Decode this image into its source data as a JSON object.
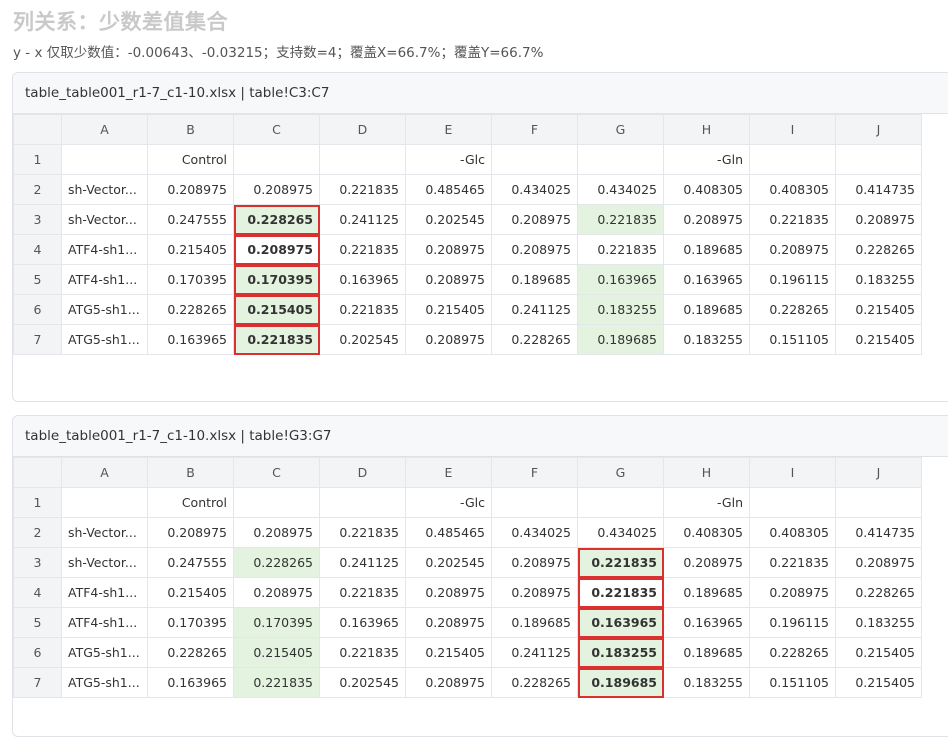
{
  "page": {
    "title": "列关系：少数差值集合",
    "subtitle": "y - x 仅取少数值：-0.00643、-0.03215；支持数=4；覆盖X=66.7%；覆盖Y=66.7%"
  },
  "columns": [
    "",
    "A",
    "B",
    "C",
    "D",
    "E",
    "F",
    "G",
    "H",
    "I",
    "J"
  ],
  "rows": [
    [
      "1",
      "",
      "Control",
      "",
      "",
      "-Glc",
      "",
      "",
      "-Gln",
      "",
      ""
    ],
    [
      "2",
      "sh-Vector...",
      "0.208975",
      "0.208975",
      "0.221835",
      "0.485465",
      "0.434025",
      "0.434025",
      "0.408305",
      "0.408305",
      "0.414735"
    ],
    [
      "3",
      "sh-Vector...",
      "0.247555",
      "0.228265",
      "0.241125",
      "0.202545",
      "0.208975",
      "0.221835",
      "0.208975",
      "0.221835",
      "0.208975"
    ],
    [
      "4",
      "ATF4-sh1...",
      "0.215405",
      "0.208975",
      "0.221835",
      "0.208975",
      "0.208975",
      "0.221835",
      "0.189685",
      "0.208975",
      "0.228265"
    ],
    [
      "5",
      "ATF4-sh1...",
      "0.170395",
      "0.170395",
      "0.163965",
      "0.208975",
      "0.189685",
      "0.163965",
      "0.163965",
      "0.196115",
      "0.183255"
    ],
    [
      "6",
      "ATG5-sh1...",
      "0.228265",
      "0.215405",
      "0.221835",
      "0.215405",
      "0.241125",
      "0.183255",
      "0.189685",
      "0.228265",
      "0.215405"
    ],
    [
      "7",
      "ATG5-sh1...",
      "0.163965",
      "0.221835",
      "0.202545",
      "0.208975",
      "0.228265",
      "0.189685",
      "0.183255",
      "0.151105",
      "0.215405"
    ]
  ],
  "highlight_rows": [
    3,
    5,
    6,
    7
  ],
  "colors": {
    "highlight": "#e3f3df",
    "selection": "#d93030"
  },
  "panels": [
    {
      "title": "table_table001_r1-7_c1-10.xlsx | table!C3:C7",
      "selected_column": "C",
      "selected_rows": [
        3,
        7
      ]
    },
    {
      "title": "table_table001_r1-7_c1-10.xlsx | table!G3:G7",
      "selected_column": "G",
      "selected_rows": [
        3,
        7
      ]
    }
  ],
  "scroll_arrow_icon": "▲"
}
